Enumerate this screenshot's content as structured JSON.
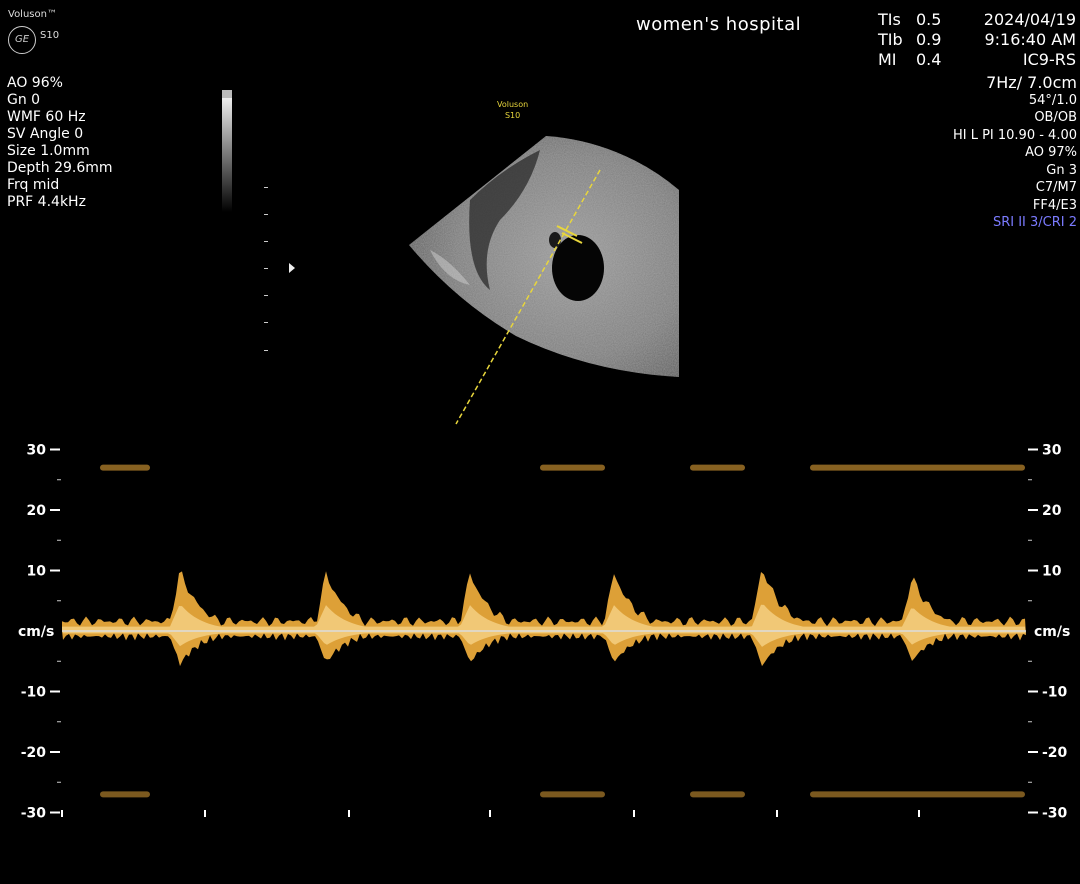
{
  "header": {
    "brand": "Voluson™",
    "logo_text": "GE",
    "model": "S10",
    "hospital": "women's  hospital"
  },
  "thermal": {
    "rows": [
      {
        "label": "TIs",
        "value": "0.5"
      },
      {
        "label": "TIb",
        "value": "0.9"
      },
      {
        "label": "MI",
        "value": "0.4"
      }
    ]
  },
  "datetime": {
    "date": "2024/04/19",
    "time": "9:16:40 AM",
    "probe": "IC9-RS"
  },
  "left_params": [
    "AO 96%",
    "Gn  0",
    "WMF 60 Hz",
    "SV Angle  0",
    "Size  1.0mm",
    "Depth 29.6mm",
    "Frq mid",
    "PRF  4.4kHz"
  ],
  "right_params": {
    "frame": "7Hz/ 7.0cm",
    "lines": [
      "54°/1.0",
      "OB/OB",
      "HI L PI 10.90 - 4.00",
      "AO 97%",
      "Gn  3",
      "C7/M7",
      "FF4/E3"
    ],
    "sri": "SRI II 3/CRI 2"
  },
  "bmode": {
    "probe_label_line1": "Voluson",
    "probe_label_line2": "S10"
  },
  "doppler": {
    "unit_label": "cm/s",
    "scale_ticks": [
      "30",
      "20",
      "10",
      "-10",
      "-20",
      "-30"
    ],
    "scale_values": [
      30,
      20,
      10,
      -10,
      -20,
      -30
    ],
    "peak_velocities_cm_s": [
      10,
      9.5,
      9.5,
      9.5,
      10.5,
      9
    ]
  },
  "colors": {
    "doppler_trace": "#f5b13d",
    "caliper": "#e8d63c",
    "sri_text": "#7b7bff"
  }
}
